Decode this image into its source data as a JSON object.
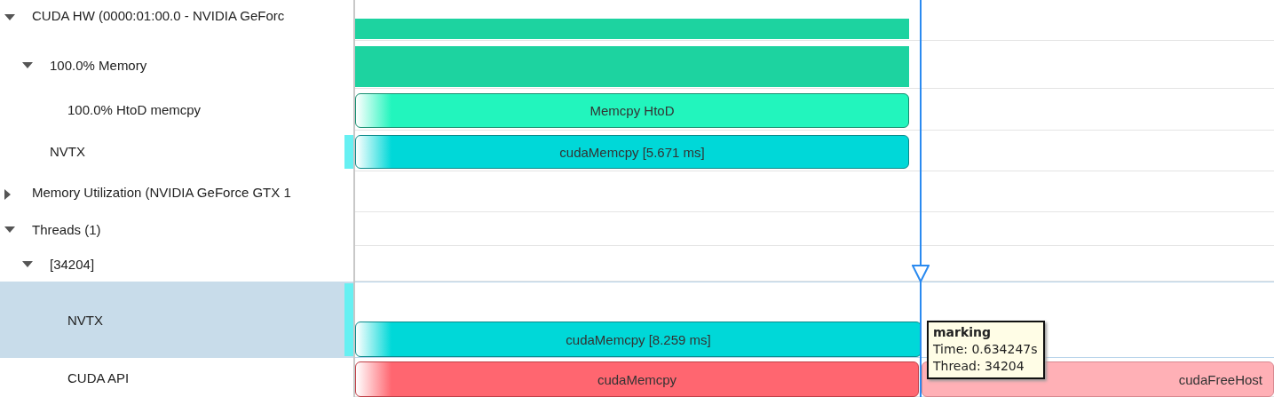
{
  "tree": [
    {
      "label": "CUDA HW (0000:01:00.0 - NVIDIA GeForc",
      "expanded": true,
      "selected": false,
      "bars": [
        {
          "kind": "fill"
        }
      ],
      "children": [
        {
          "label": "100.0% Memory",
          "expanded": true,
          "selected": false,
          "bars": [
            {
              "kind": "fill"
            }
          ],
          "children": [
            {
              "label": "100.0% HtoD memcpy",
              "selected": false,
              "bars": [
                {
                  "kind": "memcpy",
                  "label": "Memcpy HtoD"
                }
              ]
            }
          ]
        },
        {
          "label": "NVTX",
          "selected": false,
          "bars": [
            {
              "kind": "nvtx",
              "label": "cudaMemcpy [5.671 ms]"
            }
          ]
        }
      ]
    },
    {
      "label": "Memory Utilization (NVIDIA GeForce GTX 1",
      "expanded": false,
      "selected": false
    },
    {
      "label": "Threads (1)",
      "expanded": true,
      "selected": false,
      "children": [
        {
          "label": "[34204]",
          "expanded": true,
          "selected": false,
          "children": [
            {
              "label": "NVTX",
              "selected": true,
              "bars": [
                {
                  "kind": "nvtx",
                  "label": "cudaMemcpy [8.259 ms]"
                }
              ]
            },
            {
              "label": "CUDA API",
              "selected": false,
              "bars": [
                {
                  "kind": "api",
                  "label": "cudaMemcpy"
                },
                {
                  "kind": "api_dim",
                  "label": "cudaFreeHost"
                }
              ]
            }
          ]
        }
      ]
    }
  ],
  "tooltip": {
    "title": "marking",
    "lines": [
      "Time:  0.634247s",
      "Thread:  34204"
    ]
  }
}
